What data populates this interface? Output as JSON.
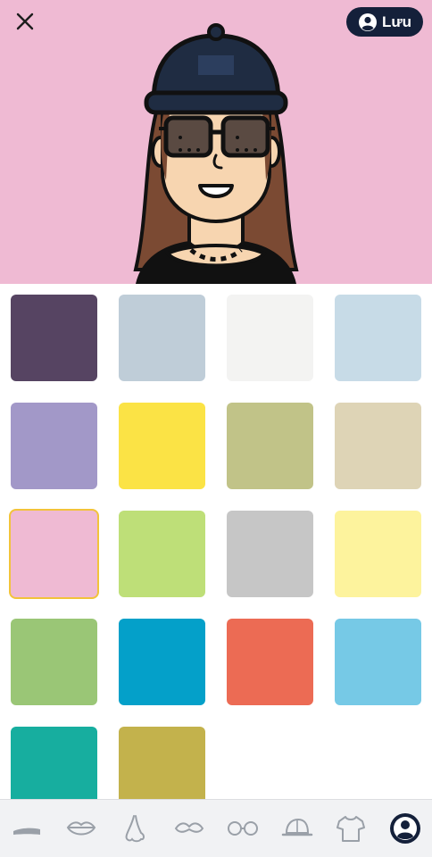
{
  "preview": {
    "background": "#efbad3",
    "save_label": "Lưu",
    "icons": {
      "close": "close-icon",
      "save": "user-circle-icon"
    }
  },
  "swatches": [
    {
      "color": "#564462",
      "selected": false
    },
    {
      "color": "#bfcdd8",
      "selected": false
    },
    {
      "color": "#f3f3f2",
      "selected": false
    },
    {
      "color": "#c7dbe7",
      "selected": false
    },
    {
      "color": "#a298c8",
      "selected": false
    },
    {
      "color": "#fbe345",
      "selected": false
    },
    {
      "color": "#c1c388",
      "selected": false
    },
    {
      "color": "#ded4b6",
      "selected": false
    },
    {
      "color": "#efbad3",
      "selected": true
    },
    {
      "color": "#bedf78",
      "selected": false
    },
    {
      "color": "#c6c6c6",
      "selected": false
    },
    {
      "color": "#fdf39d",
      "selected": false
    },
    {
      "color": "#9ac676",
      "selected": false
    },
    {
      "color": "#04a0c9",
      "selected": false
    },
    {
      "color": "#ec6b54",
      "selected": false
    },
    {
      "color": "#76c9e6",
      "selected": false
    },
    {
      "color": "#17ae9f",
      "selected": false
    },
    {
      "color": "#c3b24c",
      "selected": false
    }
  ],
  "tabs": [
    {
      "icon": "eyebrow-icon",
      "active": false
    },
    {
      "icon": "lips-icon",
      "active": false
    },
    {
      "icon": "nose-icon",
      "active": false
    },
    {
      "icon": "mustache-icon",
      "active": false
    },
    {
      "icon": "glasses-icon",
      "active": false
    },
    {
      "icon": "cap-icon",
      "active": false
    },
    {
      "icon": "tshirt-icon",
      "active": false
    },
    {
      "icon": "background-icon",
      "active": true
    }
  ]
}
